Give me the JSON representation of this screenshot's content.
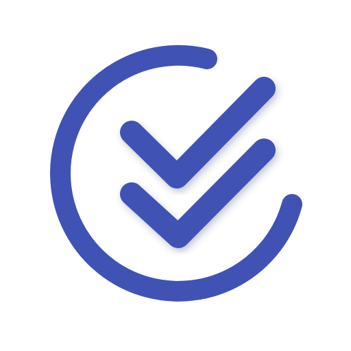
{
  "icon": {
    "name": "double-check-circle-icon",
    "color": "#4152B5",
    "shadow_color": "#2a3575"
  }
}
